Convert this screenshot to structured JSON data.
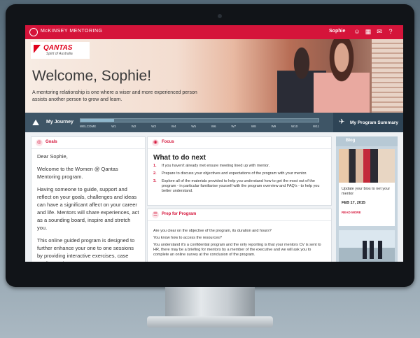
{
  "topbar": {
    "brand": "McKINSEY MENTORING",
    "user": "Sophie"
  },
  "hero": {
    "logo_text": "QANTAS",
    "logo_sub": "Spirit of Australia",
    "welcome": "Welcome, Sophie!",
    "intro": "A mentoring relationship is one where a wiser and more experienced person assists another person to grow and learn."
  },
  "journey": {
    "label": "My Journey",
    "steps": [
      "WELCOME",
      "W1",
      "W2",
      "W3",
      "W4",
      "W5",
      "W6",
      "W7",
      "W8",
      "W9",
      "W10",
      "W11"
    ],
    "progress": 0.14
  },
  "summary": {
    "label": "My Program Summary"
  },
  "goals": {
    "title": "Goals",
    "paragraphs": [
      "Dear Sophie,",
      "Welcome to the Women @ Qantas Mentoring program.",
      "Having someone to guide, support and reflect on your goals, challenges and ideas can have a significant affect on your career and life. Mentors will share experiences, act as a sounding board, inspire and stretch you.",
      "This online guided program is designed to further enhance your one to one sessions by providing interactive exercises, case studies and resources."
    ]
  },
  "focus": {
    "title": "Focus",
    "heading": "What to do next",
    "items": [
      {
        "num": "1.",
        "text": "If you haven't already met ensure meeting lined up with mentor."
      },
      {
        "num": "2.",
        "text": "Prepare to discuss your objectives and expectations of the program with your mentor."
      },
      {
        "num": "3.",
        "text": "Explore all of the materials provided to help you understand how to get the most out of the program - in particular familiarise yourself with the program overview and FAQ's - to help you better understand."
      }
    ]
  },
  "prep": {
    "title": "Prep for Program",
    "items": [
      "Are you clear on the objective of the program, its duration and hours?",
      "You know how to access the resources?",
      "You understand it's a confidential program and the only reporting is that your mentors CV is sent to HR, there may be a briefing for mentors by a member of the executive and we will ask you to complete an online survey at the conclusion of the program."
    ]
  },
  "side": {
    "title": "Blog",
    "news_text": "Update your bios to net your mentor",
    "news_date": "FEB 17, 2015",
    "read_more": "READ MORE"
  },
  "colors": {
    "accent": "#d5143a",
    "journey_bar": "#3e5566",
    "summary_bar": "#2e4456"
  }
}
